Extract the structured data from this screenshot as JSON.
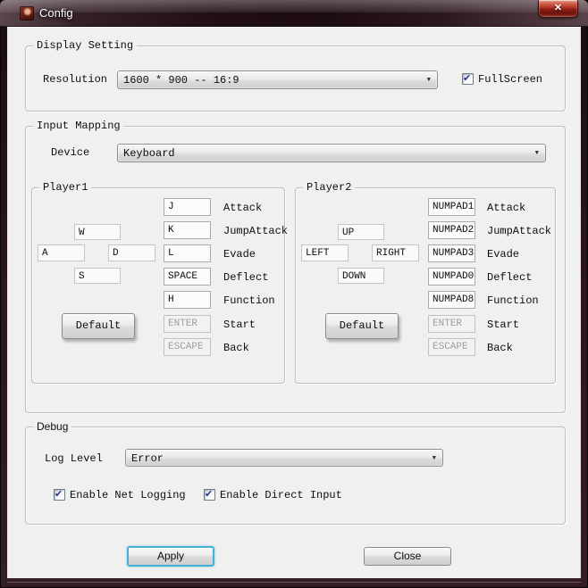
{
  "window": {
    "title": "Config"
  },
  "icons": {
    "close": "✕",
    "check": "✔",
    "dropdown_arrow": "▼"
  },
  "colors": {
    "titlebar": "#2a161c",
    "close_button_red": "#b03226",
    "client_background": "#f0f0f0",
    "focus_ring_blue": "#45b0d4",
    "checkmark_blue": "#2b3294"
  },
  "display_setting": {
    "group_label": "Display Setting",
    "resolution_label": "Resolution",
    "resolution_value": "1600 * 900 -- 16:9",
    "fullscreen_label": "FullScreen",
    "fullscreen_checked": true
  },
  "input_mapping": {
    "group_label": "Input Mapping",
    "device_label": "Device",
    "device_value": "Keyboard",
    "players": [
      {
        "group_label": "Player1",
        "default_label": "Default",
        "dpad": {
          "up": "W",
          "left": "A",
          "right": "D",
          "down": "S"
        },
        "bindings": [
          {
            "key": "J",
            "action": "Attack",
            "enabled": true
          },
          {
            "key": "K",
            "action": "JumpAttack",
            "enabled": true
          },
          {
            "key": "L",
            "action": "Evade",
            "enabled": true
          },
          {
            "key": "SPACE",
            "action": "Deflect",
            "enabled": true
          },
          {
            "key": "H",
            "action": "Function",
            "enabled": true
          },
          {
            "key": "ENTER",
            "action": "Start",
            "enabled": false
          },
          {
            "key": "ESCAPE",
            "action": "Back",
            "enabled": false
          }
        ]
      },
      {
        "group_label": "Player2",
        "default_label": "Default",
        "dpad": {
          "up": "UP",
          "left": "LEFT",
          "right": "RIGHT",
          "down": "DOWN"
        },
        "bindings": [
          {
            "key": "NUMPAD1",
            "action": "Attack",
            "enabled": true
          },
          {
            "key": "NUMPAD2",
            "action": "JumpAttack",
            "enabled": true
          },
          {
            "key": "NUMPAD3",
            "action": "Evade",
            "enabled": true
          },
          {
            "key": "NUMPAD0",
            "action": "Deflect",
            "enabled": true
          },
          {
            "key": "NUMPAD8",
            "action": "Function",
            "enabled": true
          },
          {
            "key": "ENTER",
            "action": "Start",
            "enabled": false
          },
          {
            "key": "ESCAPE",
            "action": "Back",
            "enabled": false
          }
        ]
      }
    ]
  },
  "debug": {
    "group_label": "Debug",
    "log_level_label": "Log Level",
    "log_level_value": "Error",
    "checkboxes": [
      {
        "label": "Enable Net Logging",
        "checked": true
      },
      {
        "label": "Enable Direct Input",
        "checked": true
      }
    ]
  },
  "footer": {
    "apply_label": "Apply",
    "close_label": "Close"
  }
}
